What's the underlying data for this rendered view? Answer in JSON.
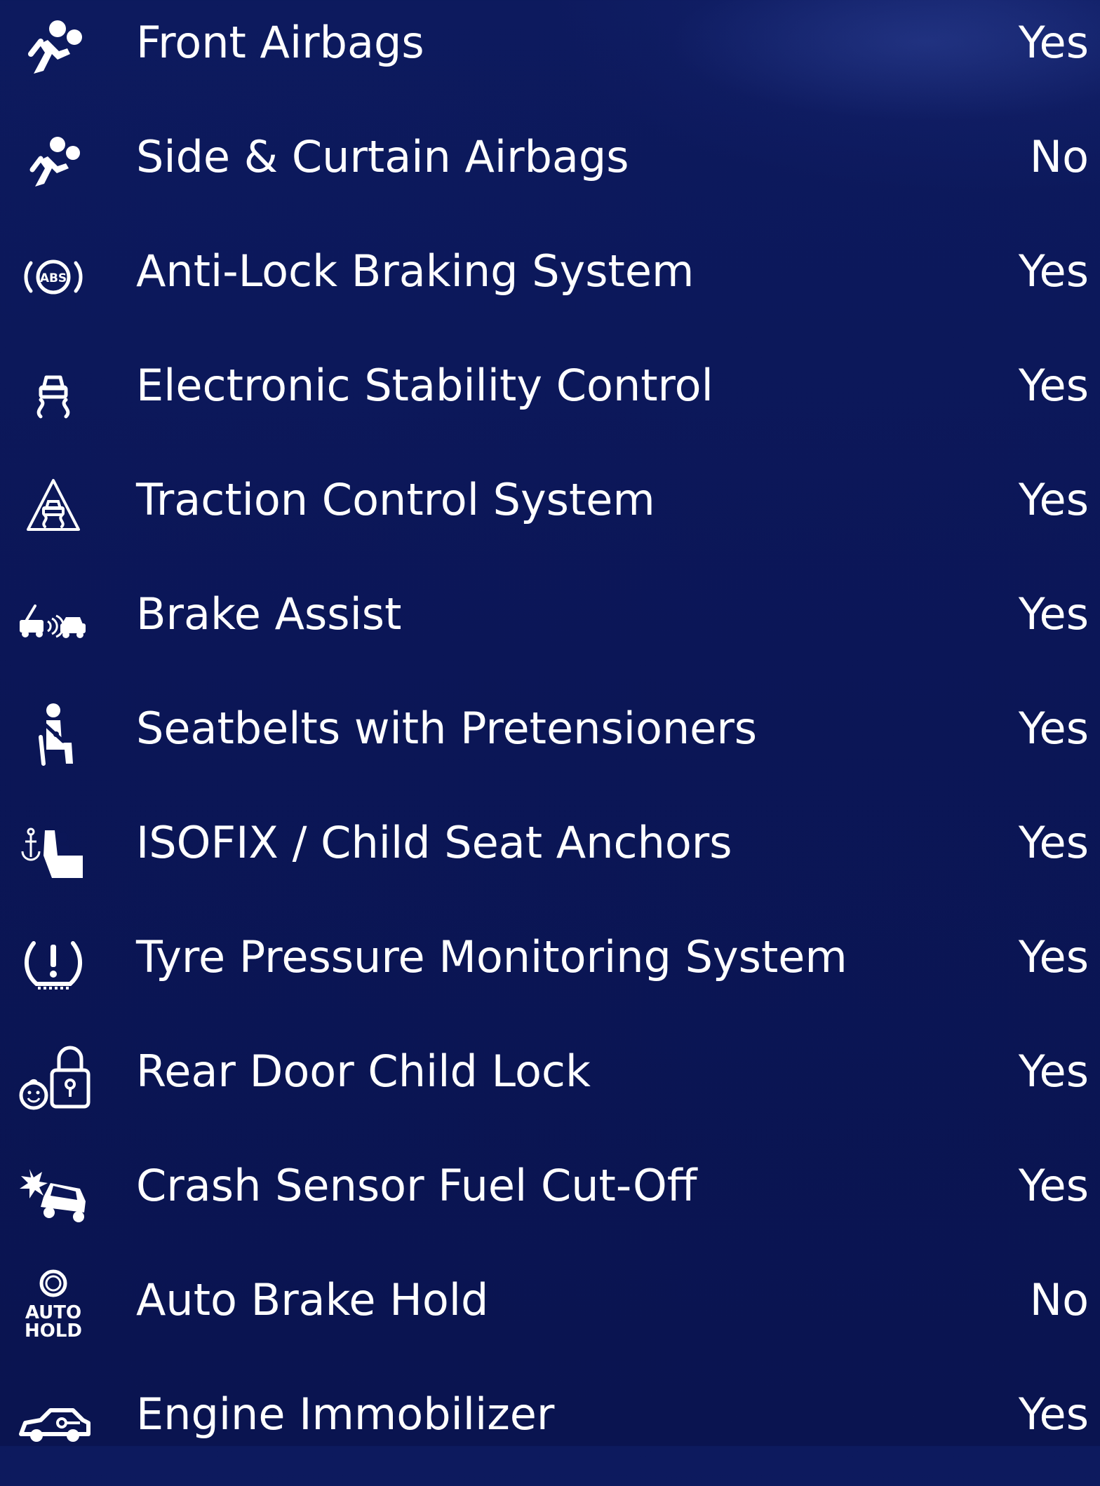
{
  "features": [
    {
      "label": "Front Airbags",
      "value": "Yes",
      "icon": "airbag-icon"
    },
    {
      "label": "Side & Curtain Airbags",
      "value": "No",
      "icon": "side-airbag-icon"
    },
    {
      "label": "Anti-Lock Braking System",
      "value": "Yes",
      "icon": "abs-icon"
    },
    {
      "label": "Electronic Stability Control",
      "value": "Yes",
      "icon": "stability-control-icon"
    },
    {
      "label": "Traction Control System",
      "value": "Yes",
      "icon": "traction-control-icon"
    },
    {
      "label": "Brake Assist",
      "value": "Yes",
      "icon": "brake-assist-icon"
    },
    {
      "label": "Seatbelts with Pretensioners",
      "value": "Yes",
      "icon": "seatbelt-icon"
    },
    {
      "label": "ISOFIX / Child Seat Anchors",
      "value": "Yes",
      "icon": "child-seat-icon"
    },
    {
      "label": "Tyre Pressure Monitoring System",
      "value": "Yes",
      "icon": "tyre-pressure-icon"
    },
    {
      "label": "Rear Door Child Lock",
      "value": "Yes",
      "icon": "child-lock-icon"
    },
    {
      "label": "Crash Sensor Fuel Cut-Off",
      "value": "Yes",
      "icon": "crash-sensor-icon"
    },
    {
      "label": "Auto Brake Hold",
      "value": "No",
      "icon": "auto-hold-icon",
      "icon_text": [
        "AUTO",
        "HOLD"
      ]
    },
    {
      "label": "Engine Immobilizer",
      "value": "Yes",
      "icon": "immobilizer-icon"
    }
  ],
  "colors": {
    "background": "#0b1657",
    "text": "#ffffff"
  }
}
